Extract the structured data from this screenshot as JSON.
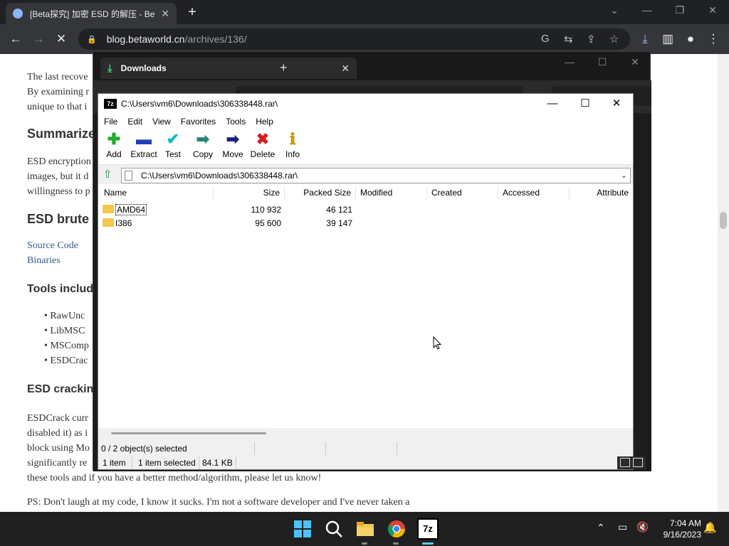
{
  "browser": {
    "tab_title": "[Beta探究] 加密 ESD 的解压 - Bet",
    "url_host": "blog.betaworld.cn",
    "url_path": "/archives/136/"
  },
  "webpage": {
    "p1": "The last recove",
    "p2": "By examining r",
    "p3": "unique to that i",
    "h_summary": "Summarize",
    "p4": "ESD encryption",
    "p5": "images, but it d",
    "p6": "willingness to p",
    "h_brute": "ESD brute",
    "link_source": "Source Code",
    "link_binaries": "Binaries",
    "h_tools": "Tools includ",
    "li1": "RawUnc",
    "li2": "LibMSC",
    "li3": "MSComp",
    "li4": "ESDCrac",
    "h_cracking": "ESD crackin",
    "p7": "ESDCrack curr",
    "p8": "disabled it) as i",
    "p9": "block using Mo",
    "p10": "significantly re",
    "p11": "these tools and if you have a better method/algorithm, please let us know!",
    "p12": "PS: Don't laugh at my code, I know it sucks. I'm not a software developer and I've never taken a"
  },
  "explorer": {
    "tab_title": "Downloads"
  },
  "sevenzip": {
    "title": "C:\\Users\\vm6\\Downloads\\306338448.rar\\",
    "logo": "7z",
    "menu": [
      "File",
      "Edit",
      "View",
      "Favorites",
      "Tools",
      "Help"
    ],
    "tools": [
      {
        "label": "Add",
        "glyph": "✚",
        "color": "#1faa2b"
      },
      {
        "label": "Extract",
        "glyph": "▬",
        "color": "#1d3fb8"
      },
      {
        "label": "Test",
        "glyph": "✔",
        "color": "#16b7c9"
      },
      {
        "label": "Copy",
        "glyph": "➡",
        "color": "#22857a"
      },
      {
        "label": "Move",
        "glyph": "➡",
        "color": "#1a237e"
      },
      {
        "label": "Delete",
        "glyph": "✖",
        "color": "#d21f1f"
      },
      {
        "label": "Info",
        "glyph": "ℹ",
        "color": "#c89a00"
      }
    ],
    "address": "C:\\Users\\vm6\\Downloads\\306338448.rar\\",
    "columns": [
      "Name",
      "Size",
      "Packed Size",
      "Modified",
      "Created",
      "Accessed",
      "Attribute"
    ],
    "rows": [
      {
        "name": "AMD64",
        "size": "110 932",
        "packed": "46 121"
      },
      {
        "name": "I386",
        "size": "95 600",
        "packed": "39 147"
      }
    ],
    "status": {
      "objects": "0 / 2 object(s) selected",
      "items": "1 item",
      "selected": "1 item selected",
      "sel_size": "84.1 KB"
    }
  },
  "taskbar": {
    "time": "7:04 AM",
    "date": "9/16/2023",
    "sevenzip_label": "7z"
  }
}
